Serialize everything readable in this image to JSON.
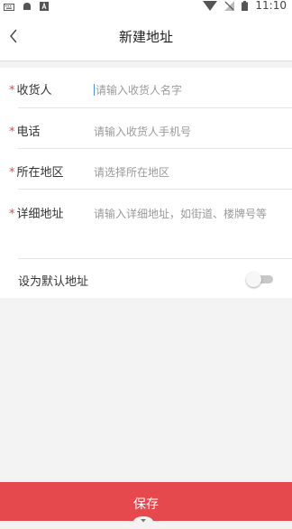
{
  "status_bar": {
    "time": "11:10",
    "icons": [
      "keyboard-icon",
      "notification-icon",
      "a-icon",
      "wifi-icon",
      "no-signal-icon",
      "battery-icon"
    ]
  },
  "nav": {
    "title": "新建地址",
    "back_icon": "chevron-left-icon"
  },
  "form": {
    "receiver": {
      "required": "*",
      "label": "收货人",
      "placeholder": "请输入收货人名字"
    },
    "phone": {
      "required": "*",
      "label": "电话",
      "placeholder": "请输入收货人手机号"
    },
    "region": {
      "required": "*",
      "label": "所在地区",
      "placeholder": "请选择所在地区"
    },
    "detail": {
      "required": "*",
      "label": "详细地址",
      "placeholder": "请输入详细地址，如街道、楼牌号等"
    },
    "default_address": {
      "label": "设为默认地址",
      "enabled": false
    }
  },
  "footer": {
    "save_label": "保存"
  },
  "colors": {
    "accent": "#e5484d",
    "background": "#f3f3f3",
    "caret": "#4a90e2"
  }
}
